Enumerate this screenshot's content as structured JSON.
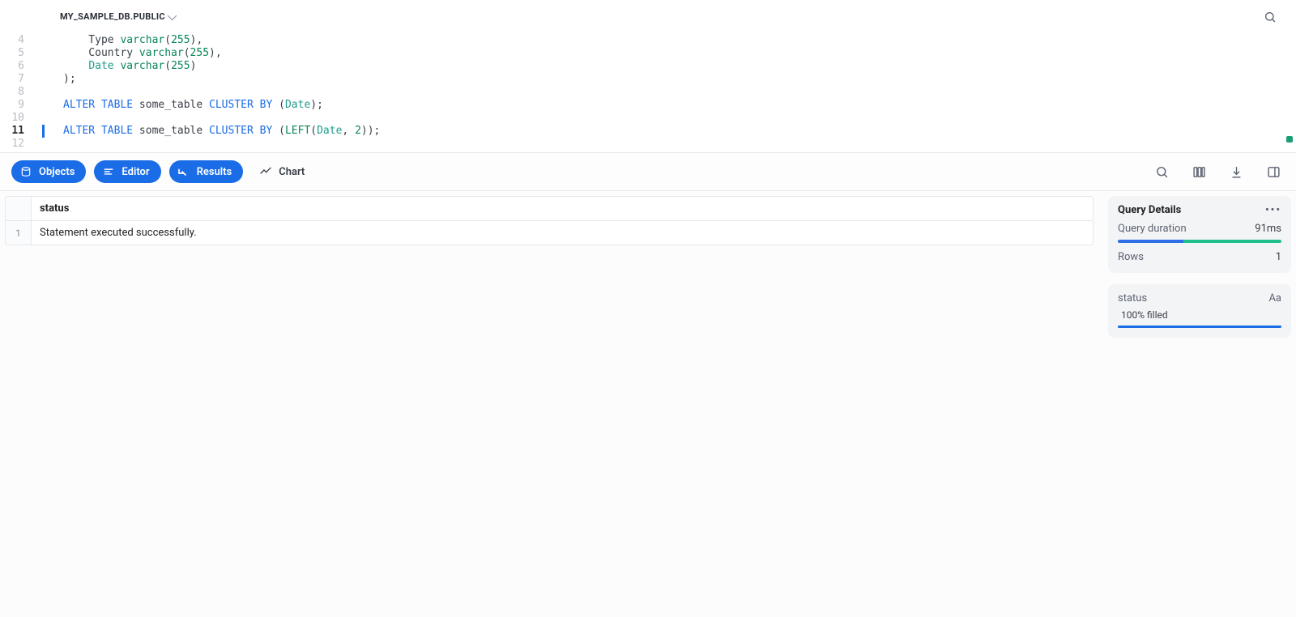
{
  "header": {
    "db_path": "MY_SAMPLE_DB.PUBLIC"
  },
  "editor": {
    "current_line": 11,
    "lines": [
      {
        "n": 4,
        "tokens": [
          [
            "    Type ",
            ""
          ],
          [
            "varchar",
            "type"
          ],
          [
            "(",
            ""
          ],
          [
            "255",
            "num"
          ],
          [
            "),",
            ""
          ]
        ]
      },
      {
        "n": 5,
        "tokens": [
          [
            "    Country ",
            ""
          ],
          [
            "varchar",
            "type"
          ],
          [
            "(",
            ""
          ],
          [
            "255",
            "num"
          ],
          [
            "),",
            ""
          ]
        ]
      },
      {
        "n": 6,
        "tokens": [
          [
            "    ",
            ""
          ],
          [
            "Date",
            "id"
          ],
          [
            " ",
            ""
          ],
          [
            "varchar",
            "type"
          ],
          [
            "(",
            ""
          ],
          [
            "255",
            "num"
          ],
          [
            ")",
            ""
          ]
        ]
      },
      {
        "n": 7,
        "tokens": [
          [
            ");",
            ""
          ]
        ]
      },
      {
        "n": 8,
        "tokens": [
          [
            "",
            ""
          ]
        ]
      },
      {
        "n": 9,
        "tokens": [
          [
            "ALTER",
            "kw"
          ],
          [
            " ",
            ""
          ],
          [
            "TABLE",
            "kw"
          ],
          [
            " some_table ",
            ""
          ],
          [
            "CLUSTER",
            "kw"
          ],
          [
            " ",
            ""
          ],
          [
            "BY",
            "kw"
          ],
          [
            " (",
            ""
          ],
          [
            "Date",
            "id"
          ],
          [
            ");",
            ""
          ]
        ]
      },
      {
        "n": 10,
        "tokens": [
          [
            "",
            ""
          ]
        ]
      },
      {
        "n": 11,
        "tokens": [
          [
            "ALTER",
            "kw"
          ],
          [
            " ",
            ""
          ],
          [
            "TABLE",
            "kw"
          ],
          [
            " some_table ",
            ""
          ],
          [
            "CLUSTER",
            "kw"
          ],
          [
            " ",
            ""
          ],
          [
            "BY",
            "kw"
          ],
          [
            " (",
            ""
          ],
          [
            "LEFT",
            "fn"
          ],
          [
            "(",
            ""
          ],
          [
            "Date",
            "id"
          ],
          [
            ", ",
            ""
          ],
          [
            "2",
            "num"
          ],
          [
            "));",
            ""
          ]
        ]
      },
      {
        "n": 12,
        "tokens": [
          [
            "",
            ""
          ]
        ]
      }
    ]
  },
  "tabs": {
    "objects": "Objects",
    "editor": "Editor",
    "results": "Results",
    "chart": "Chart"
  },
  "results": {
    "columns": [
      "status"
    ],
    "rows": [
      {
        "idx": "1",
        "cells": [
          "Statement executed successfully."
        ]
      }
    ]
  },
  "query_details": {
    "title": "Query Details",
    "duration_label": "Query duration",
    "duration_value": "91ms",
    "bar_split_pct": 40,
    "rows_label": "Rows",
    "rows_value": "1"
  },
  "column_panel": {
    "name": "status",
    "type_glyph": "Aa",
    "filled_label": "100% filled",
    "filled_pct": 100
  }
}
